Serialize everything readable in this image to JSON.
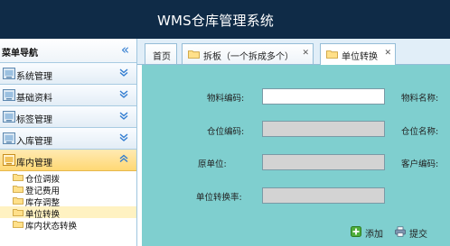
{
  "app": {
    "title": "WMS仓库管理系统"
  },
  "sidebar": {
    "header": "菜单导航",
    "sections": [
      {
        "label": "系统管理",
        "expanded": false
      },
      {
        "label": "基础资料",
        "expanded": false
      },
      {
        "label": "标签管理",
        "expanded": false
      },
      {
        "label": "入库管理",
        "expanded": false
      },
      {
        "label": "库内管理",
        "expanded": true
      }
    ],
    "subitems": [
      {
        "label": "仓位调拨",
        "selected": false
      },
      {
        "label": "登记费用",
        "selected": false
      },
      {
        "label": "库存调整",
        "selected": false
      },
      {
        "label": "单位转换",
        "selected": true
      },
      {
        "label": "库内状态转换",
        "selected": false
      }
    ]
  },
  "tabs": [
    {
      "label": "首页",
      "closable": false,
      "active": false
    },
    {
      "label": "拆板（一个拆成多个）",
      "closable": true,
      "active": false
    },
    {
      "label": "单位转换",
      "closable": true,
      "active": true
    }
  ],
  "form": {
    "material_code": {
      "label": "物料编码:",
      "value": ""
    },
    "material_name": {
      "label": "物料名称:"
    },
    "bin_code": {
      "label": "仓位编码:",
      "value": ""
    },
    "bin_name": {
      "label": "仓位名称:"
    },
    "original_unit": {
      "label": "原单位:",
      "value": ""
    },
    "customer_code": {
      "label": "客户编码:"
    },
    "conversion_rate": {
      "label": "单位转换率:",
      "value": ""
    }
  },
  "actions": {
    "add_label": "添加",
    "submit_label": "提交"
  },
  "colors": {
    "header_bg": "#0f2b47",
    "content_bg": "#7fcfcf",
    "active_section": "#ffd874",
    "selected_item": "#fff2c2",
    "accent_blue": "#2f7bd0"
  }
}
